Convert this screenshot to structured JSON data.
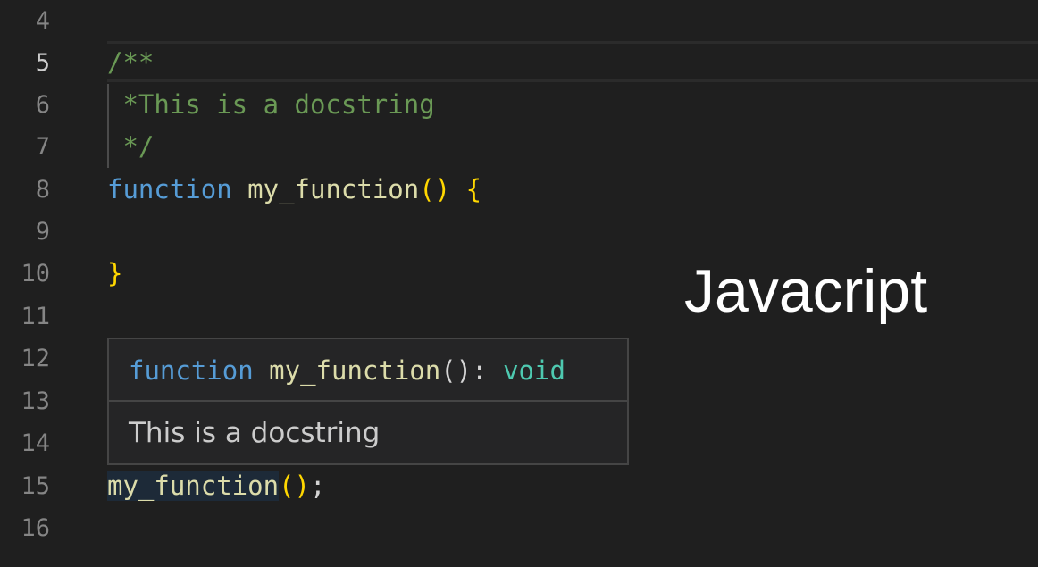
{
  "editor": {
    "line_numbers": [
      "4",
      "5",
      "6",
      "7",
      "8",
      "9",
      "10",
      "11",
      "12",
      "13",
      "14",
      "15",
      "16"
    ],
    "active_line": "5",
    "code": {
      "line5": "/**",
      "line6": " *This is a docstring",
      "line7": " */",
      "line8": {
        "keyword": "function",
        "name": "my_function",
        "open_paren": "(",
        "close_paren": ")",
        "brace": "{"
      },
      "line10": {
        "brace": "}"
      },
      "line15": {
        "name": "my_function",
        "open_paren": "(",
        "close_paren": ")",
        "semicolon": ";"
      }
    }
  },
  "hover": {
    "signature": {
      "keyword": "function",
      "name": "my_function",
      "parens": "()",
      "colon": ":",
      "return_type": "void"
    },
    "doc": "This is a docstring"
  },
  "language_label": "Javacript",
  "colors": {
    "background": "#1f1f1f",
    "comment": "#6a9955",
    "keyword": "#569cd6",
    "function": "#dcdcaa",
    "bracket": "#ffd700",
    "type": "#4ec9b0",
    "line_number": "#858585"
  }
}
